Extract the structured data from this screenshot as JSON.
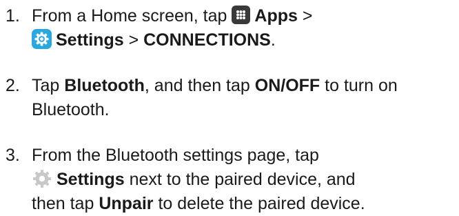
{
  "steps": [
    {
      "number": "1.",
      "line1": {
        "pre": "From a Home screen, tap ",
        "apps_icon": "apps-icon",
        "apps_label": "Apps",
        "sep": " >"
      },
      "line2": {
        "settings_icon": "settings-icon",
        "settings_label": "Settings",
        "sep": " > ",
        "connections_label": "CONNECTIONS",
        "end": "."
      }
    },
    {
      "number": "2.",
      "line1": {
        "pre": "Tap ",
        "bluetooth_label": "Bluetooth",
        "mid": ", and then tap ",
        "onoff_label": "ON/OFF",
        "post": " to turn on"
      },
      "line2": {
        "text": "Bluetooth."
      }
    },
    {
      "number": "3.",
      "line1": {
        "text": "From the Bluetooth settings page, tap"
      },
      "line2": {
        "gear_icon": "gear-icon",
        "settings_label": "Settings",
        "post": " next to the paired device, and"
      },
      "line3": {
        "pre": "then tap ",
        "unpair_label": "Unpair",
        "post": " to delete the paired device."
      }
    }
  ],
  "colors": {
    "text": "#1a1a1a",
    "apps_icon_bg": "#3a3a3a",
    "settings_icon_bg": "#29a8e0",
    "gear_icon": "#c8c8c8"
  }
}
